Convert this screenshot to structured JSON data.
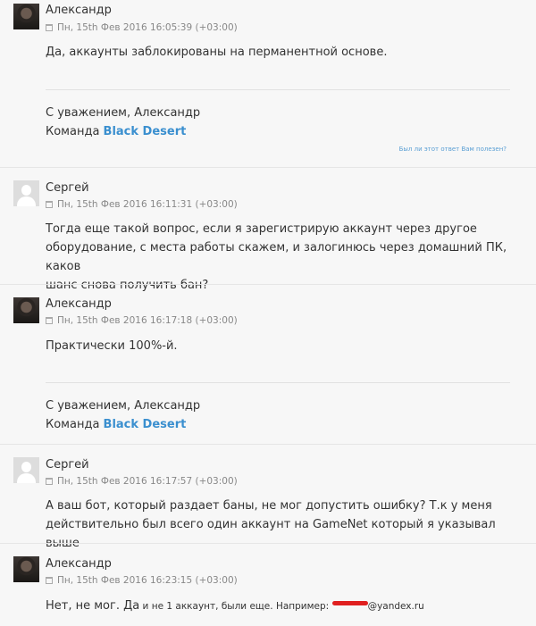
{
  "messages": [
    {
      "author": "Александр",
      "date": "Пн, 15th Фев 2016 16:05:39 (+03:00)",
      "body": "Да, аккаунты заблокированы на перманентной основе.",
      "signature_line1": "С уважением, Александр",
      "signature_team_prefix": "Команда ",
      "signature_brand": "Black Desert",
      "helpful": "Был ли этот ответ Вам полезен?"
    },
    {
      "author": "Сергей",
      "date": "Пн, 15th Фев 2016 16:11:31 (+03:00)",
      "body_lines": [
        "Тогда еще такой вопрос, если я зарегистрирую аккаунт через другое",
        "оборудование, с места работы скажем, и залогинюсь через домашний ПК, каков",
        "шанс снова получить бан?"
      ]
    },
    {
      "author": "Александр",
      "date": "Пн, 15th Фев 2016 16:17:18 (+03:00)",
      "body": "Практически 100%-й.",
      "signature_line1": "С уважением, Александр",
      "signature_team_prefix": "Команда ",
      "signature_brand": "Black Desert"
    },
    {
      "author": "Сергей",
      "date": "Пн, 15th Фев 2016 16:17:57 (+03:00)",
      "body_lines": [
        "А ваш бот, который раздает баны, не мог допустить ошибку? Т.к у меня",
        "действительно был всего один аккаунт на GameNet который я указывал выше"
      ]
    },
    {
      "author": "Александр",
      "date": "Пн, 15th Фев 2016 16:23:15 (+03:00)",
      "body_start": "Нет, не мог. Да",
      "body_small": " и не 1 аккаунт, были еще. Например: ",
      "body_email_suffix": "@yandex.ru"
    }
  ]
}
